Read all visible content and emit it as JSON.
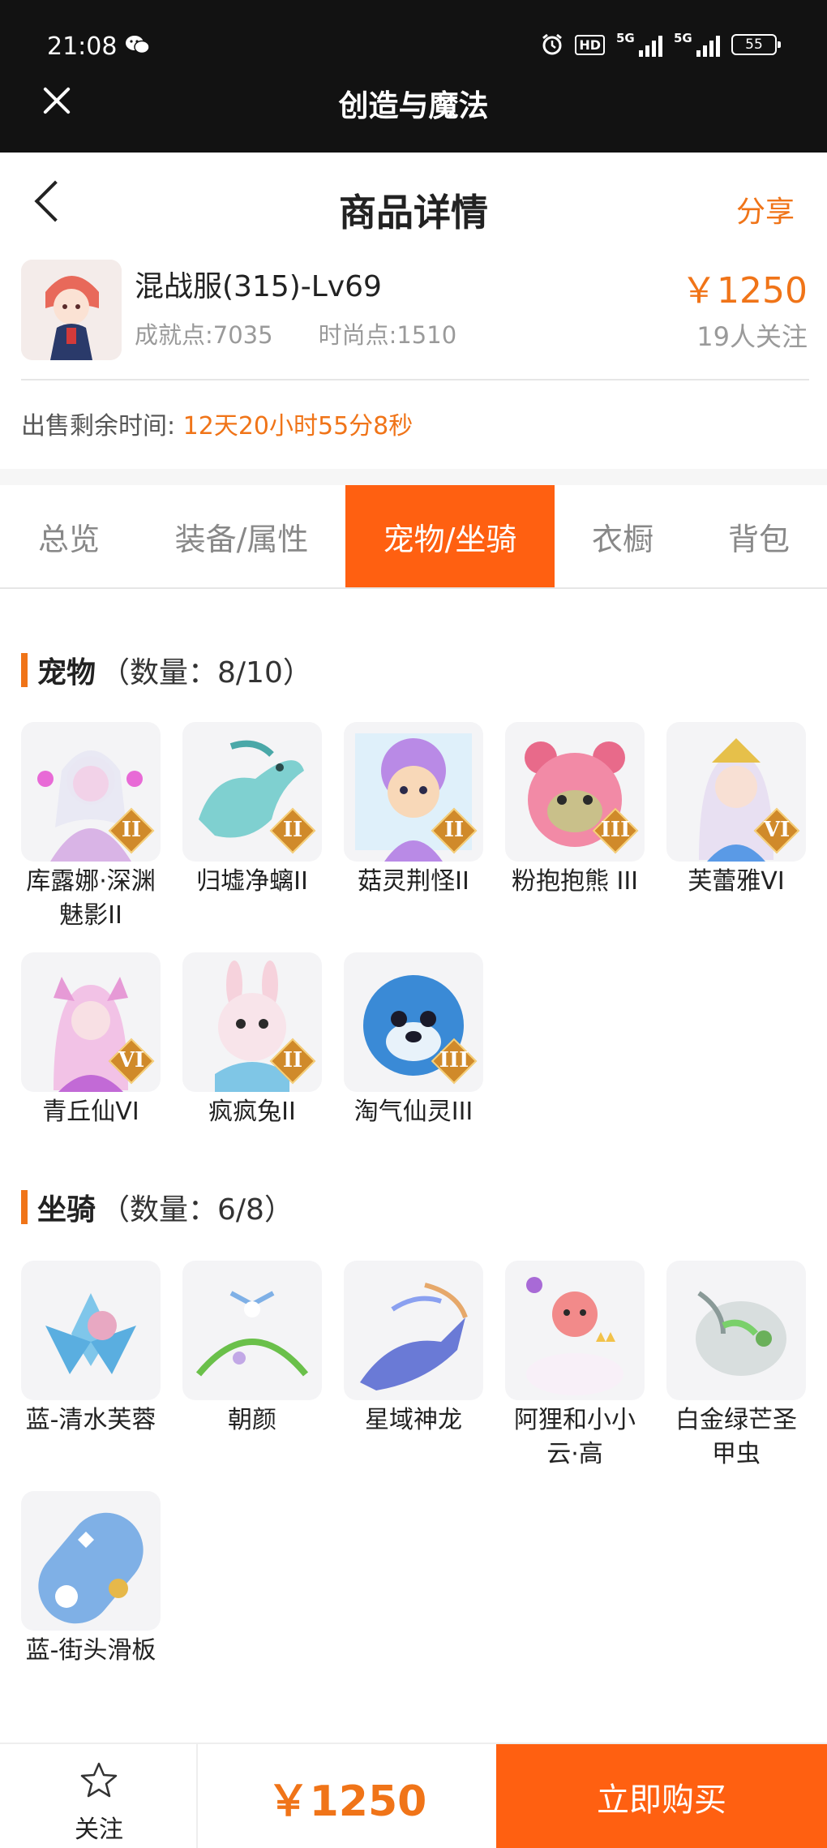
{
  "status_bar": {
    "time": "21:08",
    "hd": "HD",
    "sig1": "5G",
    "sig2": "5G",
    "battery": "55"
  },
  "app": {
    "title": "创造与魔法"
  },
  "page": {
    "title": "商品详情",
    "share": "分享"
  },
  "product": {
    "name": "混战服(315)-Lv69",
    "achievement": "成就点:7035",
    "fashion": "时尚点:1510",
    "price": "￥1250",
    "followers": "19人关注"
  },
  "timer": {
    "label": "出售剩余时间:",
    "value": "12天20小时55分8秒"
  },
  "tabs": [
    {
      "label": "总览"
    },
    {
      "label": "装备/属性"
    },
    {
      "label": "宠物/坐骑",
      "active": true
    },
    {
      "label": "衣橱"
    },
    {
      "label": "背包"
    }
  ],
  "pets": {
    "title": "宠物",
    "count": "（数量：8/10）",
    "items": [
      {
        "label": "库露娜·深渊魅影II",
        "rank": "II",
        "color": "#d9b4e6"
      },
      {
        "label": "归墟净螭II",
        "rank": "II",
        "color": "#7fd0d0"
      },
      {
        "label": "菇灵荆怪II",
        "rank": "II",
        "color": "#b98ae6"
      },
      {
        "label": "粉抱抱熊 III",
        "rank": "III",
        "color": "#f28aa6"
      },
      {
        "label": "芙蕾雅VI",
        "rank": "VI",
        "color": "#e8e0f2"
      },
      {
        "label": "青丘仙VI",
        "rank": "VI",
        "color": "#f2c2e6"
      },
      {
        "label": "疯疯兔II",
        "rank": "II",
        "color": "#f6d2dc"
      },
      {
        "label": "淘气仙灵III",
        "rank": "III",
        "color": "#3a8ad6"
      }
    ]
  },
  "mounts": {
    "title": "坐骑",
    "count": "（数量：6/8）",
    "items": [
      {
        "label": "蓝-清水芙蓉",
        "color": "#7fc6ea"
      },
      {
        "label": "朝颜",
        "color": "#9ad07a"
      },
      {
        "label": "星域神龙",
        "color": "#6a7ad6"
      },
      {
        "label": "阿狸和小小云·高",
        "color": "#f28a8a"
      },
      {
        "label": "白金绿芒圣甲虫",
        "color": "#b8c2c0"
      },
      {
        "label": "蓝-街头滑板",
        "color": "#7fb0e6"
      }
    ]
  },
  "bottom": {
    "follow_label": "关注",
    "price": "￥1250",
    "buy_label": "立即购买"
  },
  "colors": {
    "accent": "#ff6011",
    "price": "#f07418"
  }
}
